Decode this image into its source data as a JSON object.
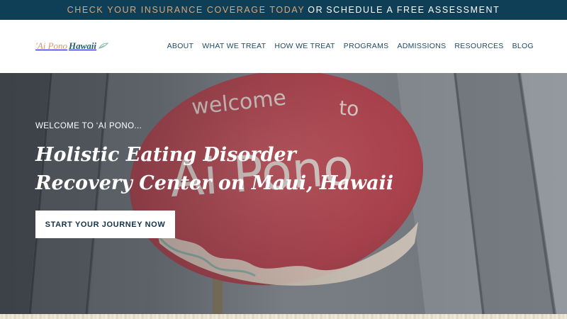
{
  "topbar": {
    "insurance_link": "CHECK YOUR INSURANCE COVERAGE TODAY",
    "separator": "OR",
    "assessment_link": "SCHEDULE A FREE ASSESSMENT"
  },
  "header": {
    "logo_word1": "'Ai Pono",
    "logo_word2": "Hawaii",
    "nav": [
      "ABOUT",
      "WHAT WE TREAT",
      "HOW WE TREAT",
      "PROGRAMS",
      "ADMISSIONS",
      "RESOURCES",
      "BLOG"
    ]
  },
  "hero": {
    "eyebrow": "WELCOME TO ‘AI PONO...",
    "title_line1": "Holistic Eating Disorder",
    "title_line2": "Recovery Center on Maui, Hawaii",
    "cta": "START YOUR JOURNEY NOW"
  },
  "colors": {
    "topbar_bg": "#0f3f57",
    "topbar_accent": "#d9a777",
    "nav_text": "#1e4a62",
    "sign_red": "#c4505a"
  }
}
